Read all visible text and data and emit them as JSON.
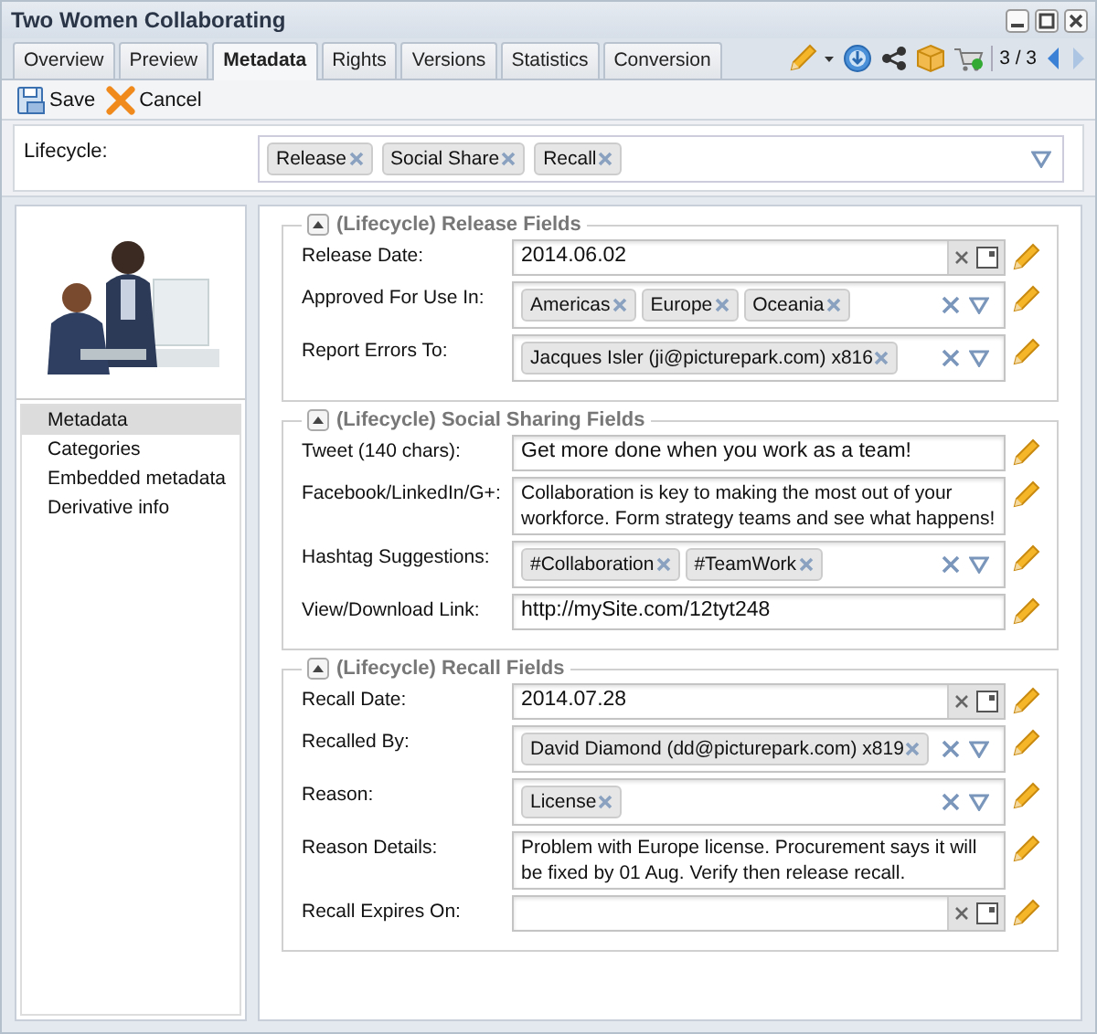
{
  "window": {
    "title": "Two Women Collaborating"
  },
  "tabs": [
    {
      "label": "Overview",
      "selected": false
    },
    {
      "label": "Preview",
      "selected": false
    },
    {
      "label": "Metadata",
      "selected": true
    },
    {
      "label": "Rights",
      "selected": false
    },
    {
      "label": "Versions",
      "selected": false
    },
    {
      "label": "Statistics",
      "selected": false
    },
    {
      "label": "Conversion",
      "selected": false
    }
  ],
  "pager": {
    "text": "3 / 3",
    "prev_disabled": false,
    "next_disabled": true
  },
  "toolbar": [
    {
      "kind": "save",
      "label": "Save"
    },
    {
      "kind": "cancel",
      "label": "Cancel"
    }
  ],
  "lifecycle": {
    "label": "Lifecycle:",
    "tags": [
      "Release",
      "Social Share",
      "Recall"
    ]
  },
  "sidebar": {
    "items": [
      {
        "label": "Metadata",
        "selected": true
      },
      {
        "label": "Categories",
        "selected": false
      },
      {
        "label": "Embedded metadata",
        "selected": false
      },
      {
        "label": "Derivative info",
        "selected": false
      }
    ]
  },
  "sections": [
    {
      "title": "(Lifecycle) Release Fields",
      "expanded": true,
      "fields": [
        {
          "kind": "date",
          "label": "Release Date:",
          "value": "2014.06.02"
        },
        {
          "kind": "tags",
          "label": "Approved For Use In:",
          "tags": [
            "Americas",
            "Europe",
            "Oceania"
          ]
        },
        {
          "kind": "tags",
          "label": "Report Errors To:",
          "tags": [
            "Jacques Isler (ji@picturepark.com) x816"
          ]
        }
      ]
    },
    {
      "title": "(Lifecycle) Social Sharing Fields",
      "expanded": true,
      "fields": [
        {
          "kind": "text",
          "label": "Tweet (140 chars):",
          "value": "Get more done when you work as a team!"
        },
        {
          "kind": "textarea",
          "label": "Facebook/LinkedIn/G+:",
          "value": "Collaboration is key to making the most out of your workforce. Form strategy teams and see what happens!"
        },
        {
          "kind": "tags",
          "label": "Hashtag Suggestions:",
          "tags": [
            "#Collaboration",
            "#TeamWork"
          ]
        },
        {
          "kind": "text",
          "label": "View/Download Link:",
          "value": "http://mySite.com/12tyt248"
        }
      ]
    },
    {
      "title": "(Lifecycle) Recall Fields",
      "expanded": true,
      "fields": [
        {
          "kind": "date",
          "label": "Recall Date:",
          "value": "2014.07.28"
        },
        {
          "kind": "tags",
          "label": "Recalled By:",
          "tags": [
            "David Diamond (dd@picturepark.com) x819"
          ]
        },
        {
          "kind": "tags",
          "label": "Reason:",
          "tags": [
            "License"
          ]
        },
        {
          "kind": "textarea",
          "label": "Reason Details:",
          "value": "Problem with Europe license. Procurement says it will be fixed by 01 Aug. Verify then release recall."
        },
        {
          "kind": "date",
          "label": "Recall Expires On:"
        }
      ]
    }
  ]
}
